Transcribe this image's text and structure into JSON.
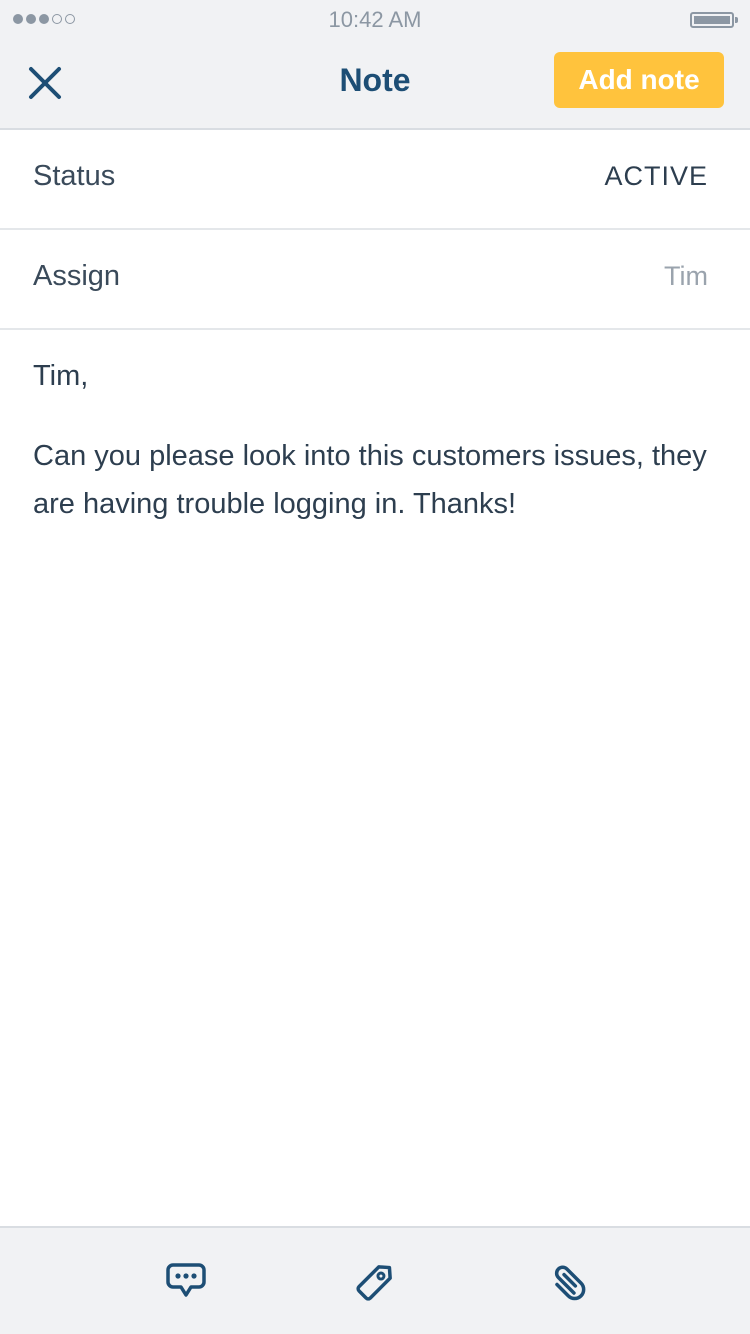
{
  "status_bar": {
    "time": "10:42 AM",
    "signal_strength": 3,
    "signal_max": 5
  },
  "nav": {
    "title": "Note",
    "add_button_label": "Add note",
    "close_icon": "close-icon"
  },
  "fields": {
    "status": {
      "label": "Status",
      "value": "ACTIVE"
    },
    "assign": {
      "label": "Assign",
      "value": "Tim"
    }
  },
  "note": {
    "greeting": "Tim,",
    "body": "Can you please look into this customers issues, they are having trouble logging in. Thanks!"
  },
  "toolbar": {
    "icons": [
      "comment-icon",
      "tag-icon",
      "attachment-icon"
    ]
  },
  "colors": {
    "accent": "#ffc33d",
    "primary": "#1d4e75",
    "text": "#2d3e4f",
    "muted": "#9aa3ad",
    "bar_background": "#f1f2f4"
  }
}
